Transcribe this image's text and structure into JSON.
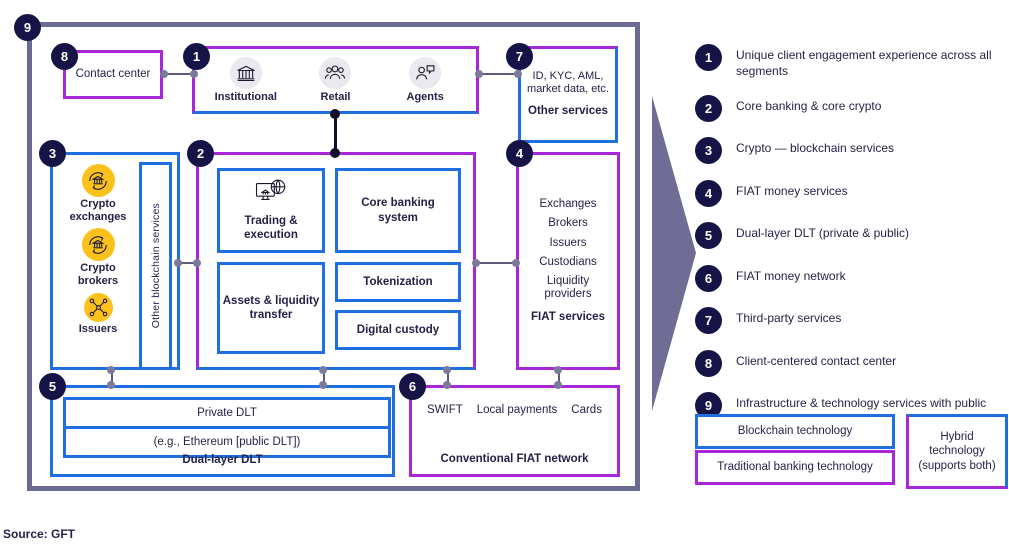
{
  "diagram": {
    "outer_frame": {
      "badge": "9"
    },
    "box1": {
      "badge": "1",
      "personas": [
        {
          "label": "Institutional",
          "icon": "bank-icon"
        },
        {
          "label": "Retail",
          "icon": "people-group-icon"
        },
        {
          "label": "Agents",
          "icon": "person-speech-bubble-icon"
        }
      ]
    },
    "box2": {
      "badge": "2",
      "items": [
        {
          "label": "Trading & execution",
          "icon": "monitor-globe-icon"
        },
        {
          "label": "Assets & liquidity transfer"
        },
        {
          "label": "Core banking system"
        },
        {
          "label": "Tokenization"
        },
        {
          "label": "Digital custody"
        }
      ]
    },
    "box3": {
      "badge": "3",
      "items": [
        {
          "label": "Crypto exchanges",
          "icon": "crypto-exchange-icon"
        },
        {
          "label": "Crypto brokers",
          "icon": "crypto-broker-icon"
        },
        {
          "label": "Issuers",
          "icon": "issuer-network-icon"
        }
      ],
      "vertical_label": "Other blockchain services"
    },
    "box4": {
      "badge": "4",
      "items": [
        "Exchanges",
        "Brokers",
        "Issuers",
        "Custodians",
        "Liquidity providers"
      ],
      "footer": "FIAT services"
    },
    "box5": {
      "badge": "5",
      "rows": [
        "Private DLT",
        "(e.g., Ethereum [public DLT])"
      ],
      "footer": "Dual-layer DLT"
    },
    "box6": {
      "badge": "6",
      "items": [
        "SWIFT",
        "Local payments",
        "Cards"
      ],
      "footer": "Conventional FIAT network"
    },
    "box7": {
      "badge": "7",
      "text": "ID, KYC, AML, market data, etc.",
      "footer": "Other services"
    },
    "box8": {
      "badge": "8",
      "label": "Contact center"
    }
  },
  "legend": {
    "items": [
      {
        "number": "1",
        "text": "Unique client engagement experience across all segments"
      },
      {
        "number": "2",
        "text": "Core banking & core crypto"
      },
      {
        "number": "3",
        "text": "Crypto — blockchain services"
      },
      {
        "number": "4",
        "text": "FIAT money services"
      },
      {
        "number": "5",
        "text": "Dual-layer DLT (private & public)"
      },
      {
        "number": "6",
        "text": "FIAT money network"
      },
      {
        "number": "7",
        "text": "Third-party services"
      },
      {
        "number": "8",
        "text": "Client-centered contact center"
      },
      {
        "number": "9",
        "text": "Infrastructure & technology services with public cloud provider"
      }
    ],
    "keys": {
      "blockchain": "Blockchain technology",
      "traditional": "Traditional banking technology",
      "hybrid": "Hybrid technology (supports both)"
    }
  },
  "source": "Source: GFT",
  "colors": {
    "blue": "#1f6fe0",
    "purple": "#a827d6",
    "navy": "#161446",
    "frame": "#6b6a90",
    "yellow": "#fcc21b",
    "arrow": "#6f6d96"
  }
}
